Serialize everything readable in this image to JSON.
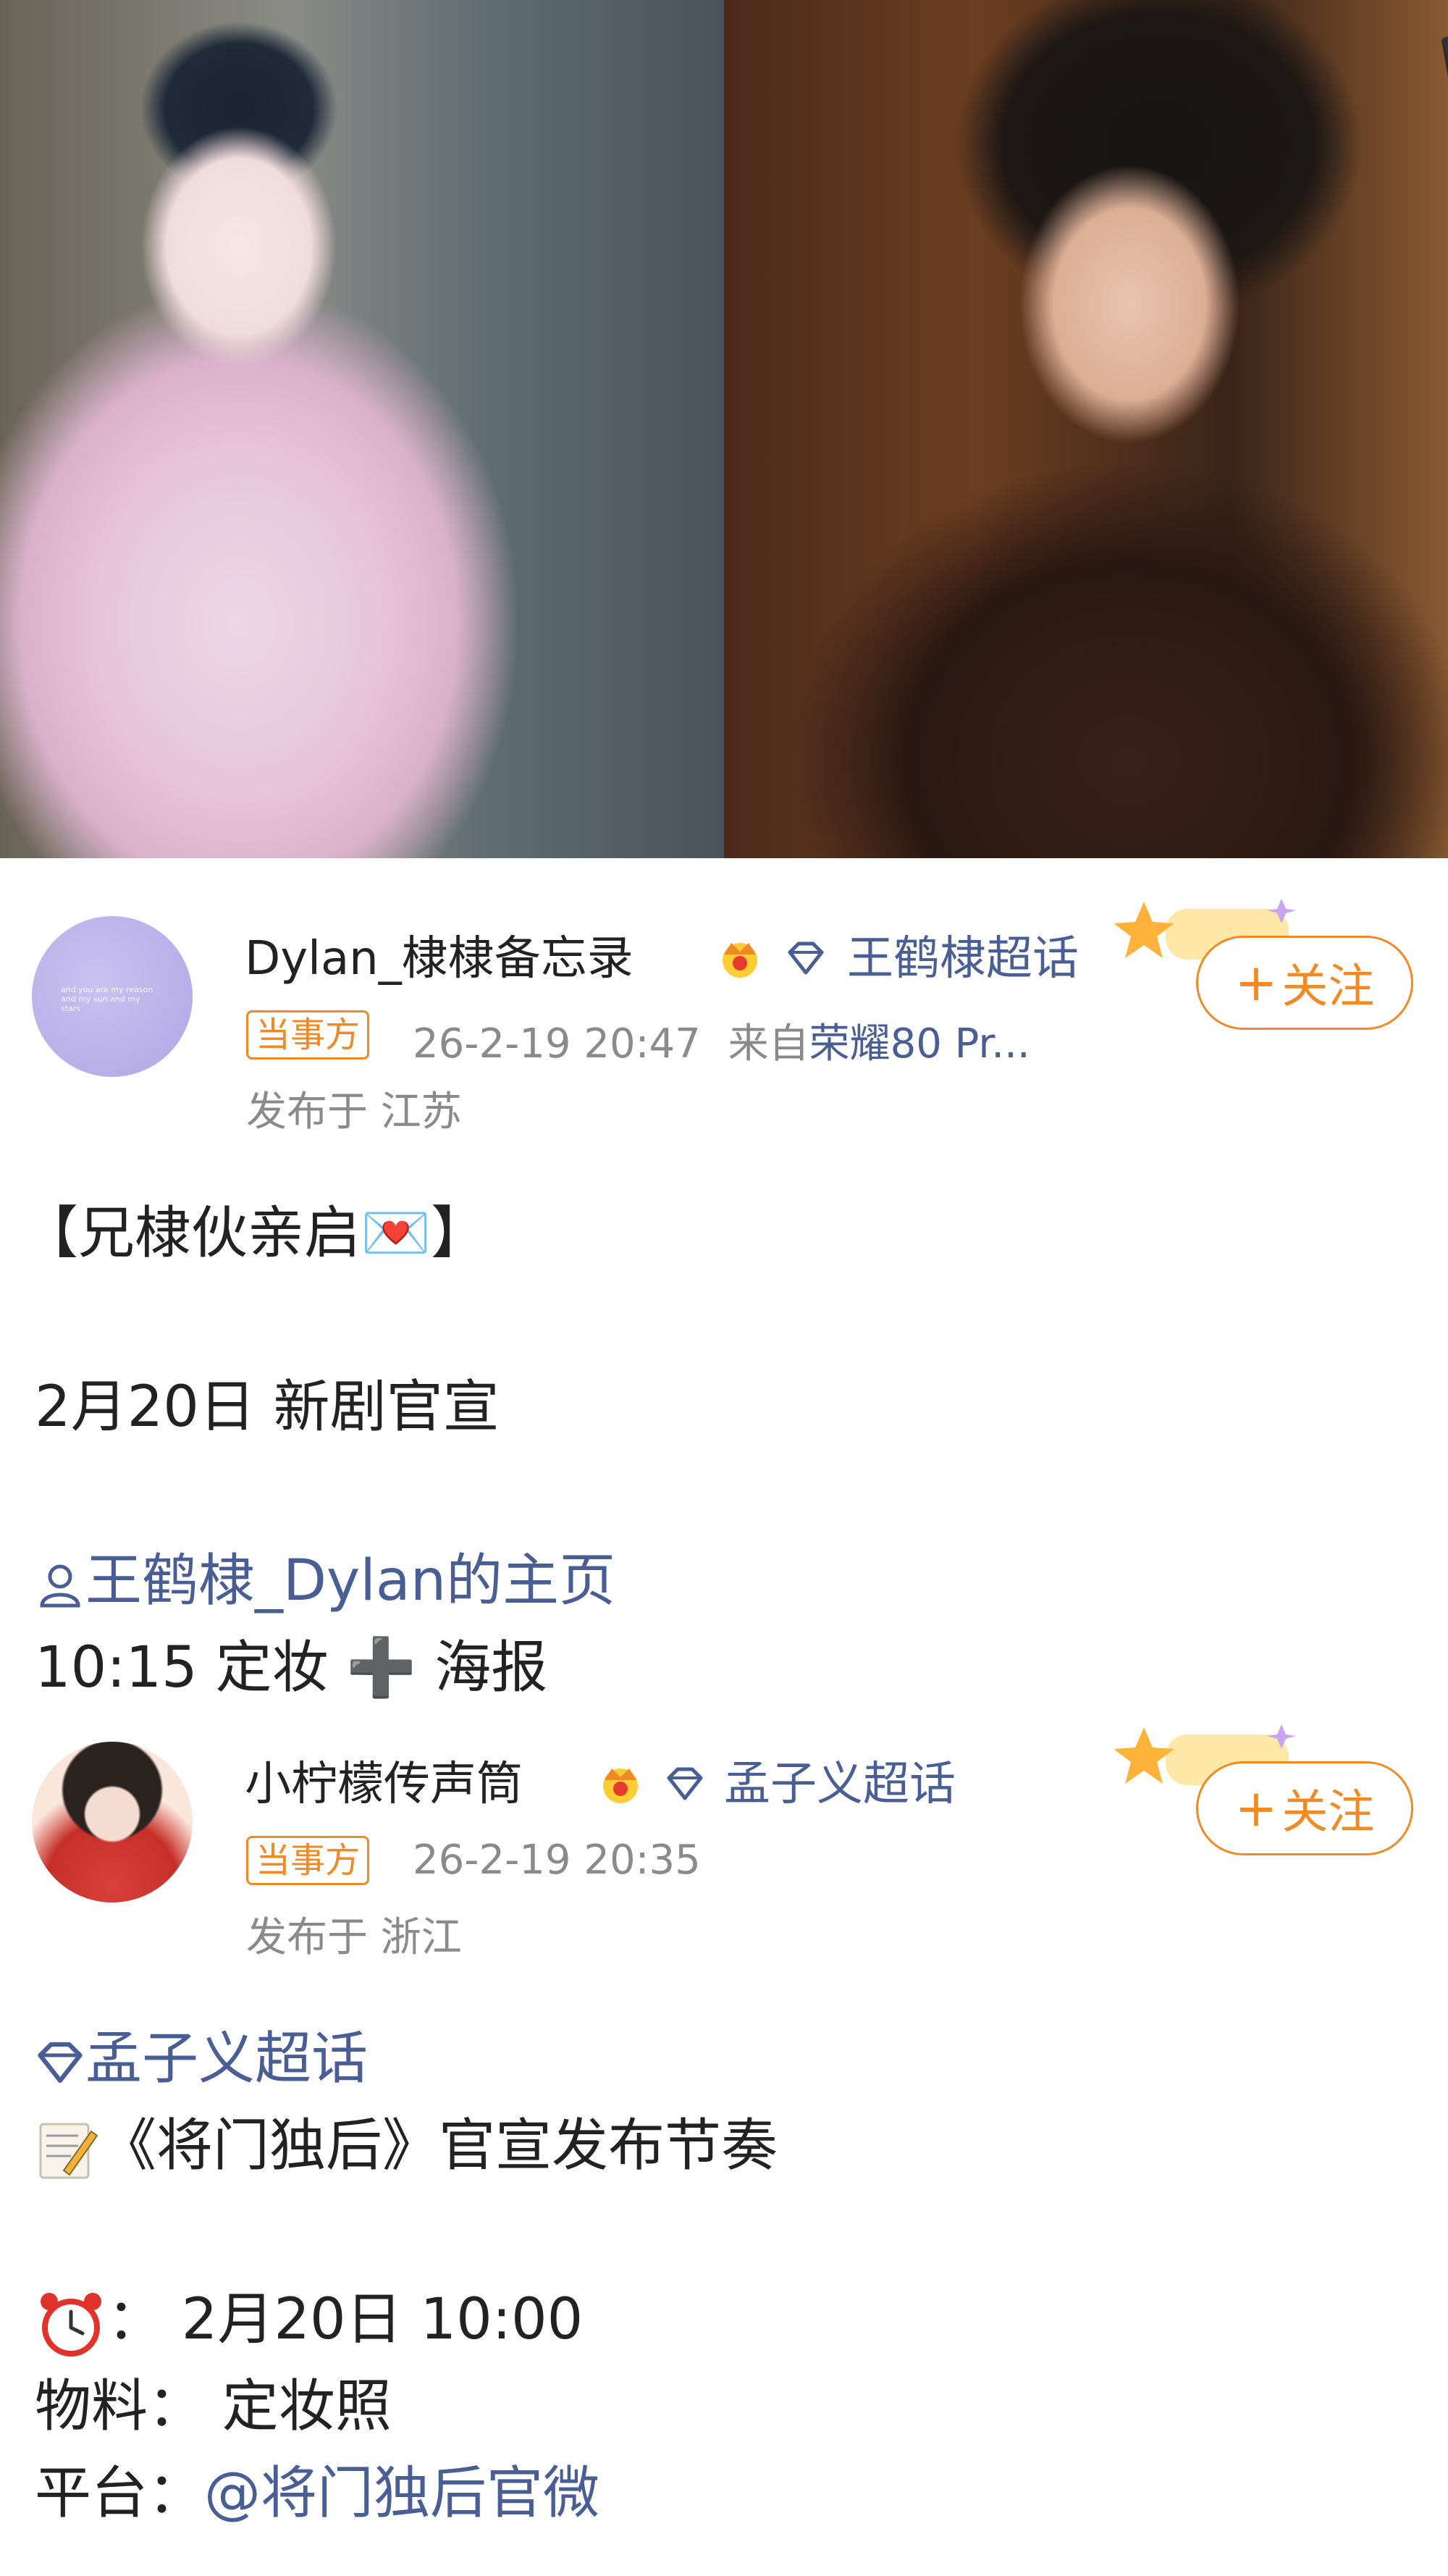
{
  "post1": {
    "username": "Dylan_棣棣备忘录",
    "topic": "王鹤棣超话",
    "badge": "当事方",
    "time": "26-2-19 20:47",
    "from_prefix": "来自",
    "device": "荣耀80 Pr...",
    "location": "发布于 江苏",
    "follow_label": "关注",
    "avatar_text": "and you are my reason and my sun and my stars",
    "lines": {
      "heading": "【兄棣伙亲启💌】",
      "date_line": "2月20日 新剧官宣",
      "profile_link": "王鹤棣_Dylan的主页",
      "schedule": "10:15 定妆 ➕ 海报"
    }
  },
  "post2": {
    "username": "小柠檬传声筒",
    "topic": "孟子义超话",
    "badge": "当事方",
    "time": "26-2-19 20:35",
    "location": "发布于 浙江",
    "follow_label": "关注",
    "lines": {
      "topic_link": "孟子义超话",
      "title": "《将门独后》官宣发布节奏",
      "time_line": "： 2月20日 10:00",
      "material": "物料： 定妆照",
      "platform_label": "平台：",
      "platform_link": "@将门独后官微"
    }
  },
  "icons": {
    "crown": "crown-badge-icon",
    "diamond": "superchat-diamond-icon",
    "person": "person-icon",
    "memo": "memo-icon",
    "clock": "alarm-clock-icon"
  },
  "colors": {
    "link": "#4a5e96",
    "accent": "#f08a24",
    "meta": "#8a8a8a"
  }
}
